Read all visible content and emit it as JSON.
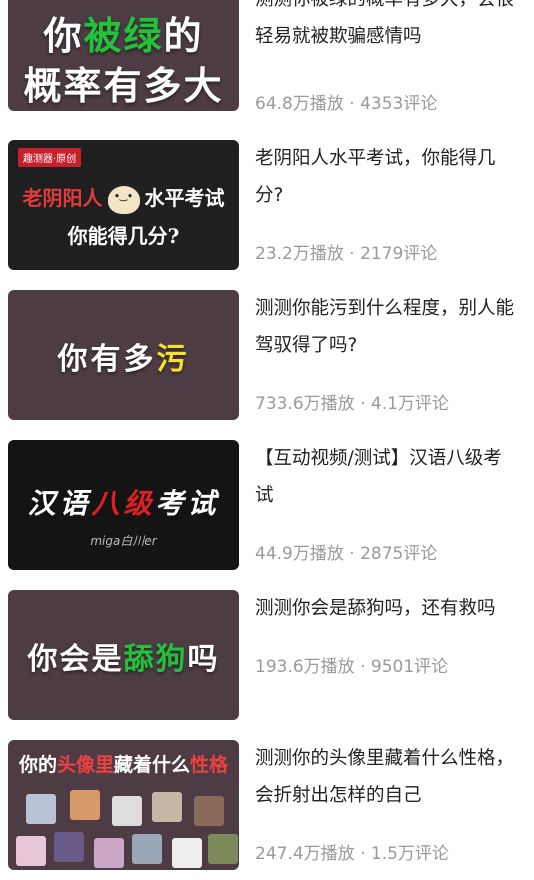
{
  "items": [
    {
      "title": "测测你被绿的概率有多大，会很轻易就被欺骗感情吗",
      "stats": "64.8万播放 · 4353评论",
      "thumb": {
        "bg": "#4d3c44",
        "line1_pre": "你",
        "line1_hl": "被绿",
        "line1_post": "的",
        "line2": "概率有多大",
        "hl_color": "#22c23a"
      }
    },
    {
      "title": "老阴阳人水平考试，你能得几分?",
      "stats": "23.2万播放 · 2179评论",
      "thumb": {
        "bg": "#1f1f1f",
        "tag": "趣测器·原创",
        "line1_pre": "老阴阳人",
        "line1_post": "水平考试",
        "line2": "你能得几分?",
        "pre_color": "#e23b3b"
      }
    },
    {
      "title": "测测你能污到什么程度，别人能驾驭得了吗?",
      "stats": "733.6万播放 · 4.1万评论",
      "thumb": {
        "bg": "#4d3c44",
        "pre": "你有多",
        "hl": "污",
        "hl_color": "#f5e22a"
      }
    },
    {
      "title": "【互动视频/测试】汉语八级考试",
      "stats": "44.9万播放 · 2875评论",
      "thumb": {
        "bg": "#141414",
        "pre": "汉语",
        "hl": "八级",
        "post": "考试",
        "hl_color": "#e02020",
        "sub": "miga白川er"
      }
    },
    {
      "title": "测测你会是舔狗吗，还有救吗",
      "stats": "193.6万播放 · 9501评论",
      "thumb": {
        "bg": "#4d3c44",
        "pre": "你会是",
        "hl": "舔狗",
        "post": "吗",
        "hl_color": "#22c23a"
      }
    },
    {
      "title": "测测你的头像里藏着什么性格，会折射出怎样的自己",
      "stats": "247.4万播放 · 1.5万评论",
      "thumb": {
        "bg": "#4d3c44",
        "p1": "你的",
        "h1": "头像里",
        "p2": "藏着什么",
        "h2": "性格",
        "hl_color": "#f04040"
      }
    }
  ]
}
